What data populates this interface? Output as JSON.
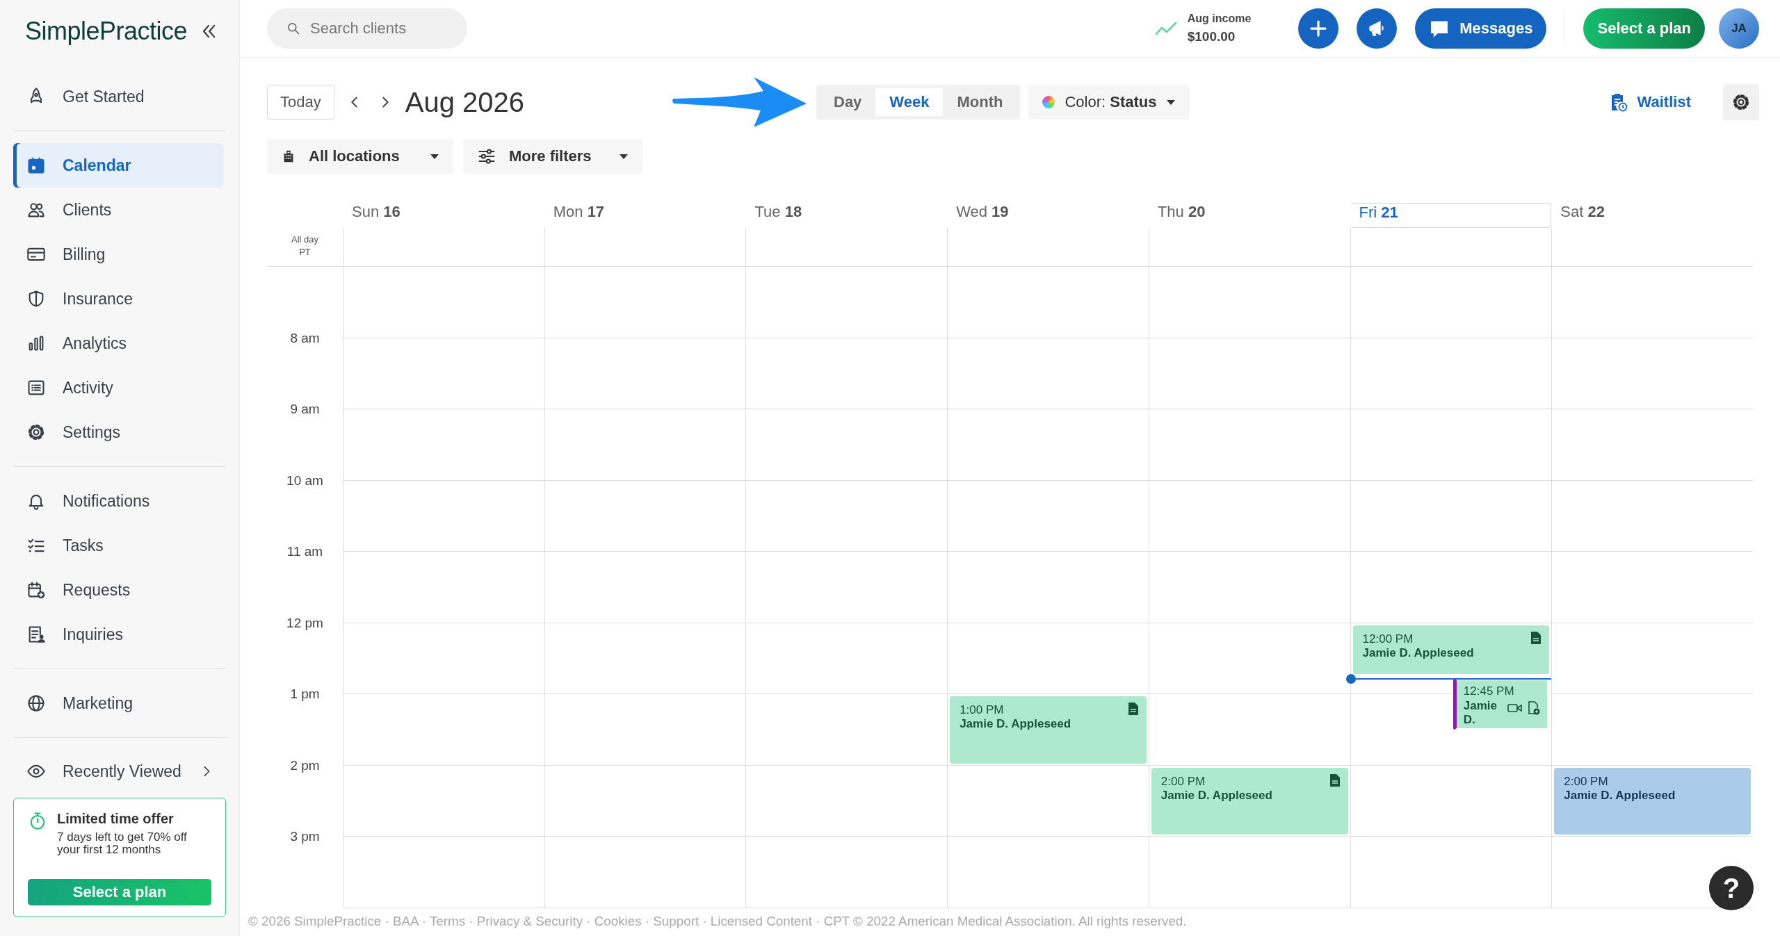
{
  "sidebar": {
    "logo": "SimplePractice",
    "sections": [
      [
        {
          "label": "Get Started",
          "selected": false
        }
      ],
      [
        {
          "label": "Calendar",
          "selected": true
        },
        {
          "label": "Clients",
          "selected": false
        },
        {
          "label": "Billing",
          "selected": false
        },
        {
          "label": "Insurance",
          "selected": false
        },
        {
          "label": "Analytics",
          "selected": false
        },
        {
          "label": "Activity",
          "selected": false
        },
        {
          "label": "Settings",
          "selected": false
        }
      ],
      [
        {
          "label": "Notifications",
          "selected": false
        },
        {
          "label": "Tasks",
          "selected": false
        },
        {
          "label": "Requests",
          "selected": false
        },
        {
          "label": "Inquiries",
          "selected": false
        }
      ],
      [
        {
          "label": "Marketing",
          "selected": false
        }
      ]
    ],
    "recently_viewed": "Recently Viewed",
    "promo": {
      "title": "Limited time offer",
      "text": "7 days left to get 70% off your first 12 months",
      "button": "Select a plan"
    }
  },
  "top_bar": {
    "search": {
      "placeholder": "Search clients"
    },
    "income": {
      "label": "Aug income",
      "value": "$100.00"
    },
    "messages": "Messages",
    "plan_button": "Select a plan",
    "avatar": "JA"
  },
  "toolbar": {
    "today": "Today",
    "title": "Aug 2026",
    "views": [
      {
        "label": "Day",
        "selected": false
      },
      {
        "label": "Week",
        "selected": true
      },
      {
        "label": "Month",
        "selected": false
      }
    ],
    "color_filter": {
      "label": "Color:",
      "value": "Status"
    },
    "waitlist": "Waitlist",
    "filters": [
      "All locations",
      "More filters"
    ]
  },
  "calendar": {
    "all_day": [
      "All day",
      "PT"
    ],
    "hours": [
      "8 am",
      "9 am",
      "10 am",
      "11 am",
      "12 pm",
      "1 pm",
      "2 pm",
      "3 pm"
    ],
    "days": [
      {
        "name": "Sun",
        "date": "16",
        "today": false
      },
      {
        "name": "Mon",
        "date": "17",
        "today": false
      },
      {
        "name": "Tue",
        "date": "18",
        "today": false
      },
      {
        "name": "Wed",
        "date": "19",
        "today": false,
        "events": [
          {
            "time": "1:00 PM",
            "client": "Jamie D. Appleseed",
            "color": "#aee9cf",
            "note": true,
            "video": false,
            "overlapping": false
          }
        ]
      },
      {
        "name": "Thu",
        "date": "20",
        "today": false,
        "events": [
          {
            "time": "2:00 PM",
            "client": "Jamie D. Appleseed",
            "color": "#aee9cf",
            "note": true,
            "video": false,
            "overlapping": false
          }
        ]
      },
      {
        "name": "Fri",
        "date": "21",
        "today": true,
        "events": [
          {
            "time": "12:00 PM",
            "client": "Jamie D. Appleseed",
            "color": "#aee9cf",
            "note": true,
            "video": false,
            "overlapping": false
          },
          {
            "time": "12:45 PM",
            "client": "Jamie D.",
            "color": "#aee9cf",
            "note": false,
            "video": true,
            "overlapping": true
          }
        ]
      },
      {
        "name": "Sat",
        "date": "22",
        "today": false,
        "events": [
          {
            "time": "2:00 PM",
            "client": "Jamie D. Appleseed",
            "color": "#abcbeb",
            "note": false,
            "video": false,
            "overlapping": false
          }
        ]
      }
    ]
  },
  "help": "?",
  "footer": "© 2026 SimplePractice · BAA · Terms · Privacy & Security · Cookies · Support · Licensed Content · CPT © 2022 American Medical Association. All rights reserved."
}
